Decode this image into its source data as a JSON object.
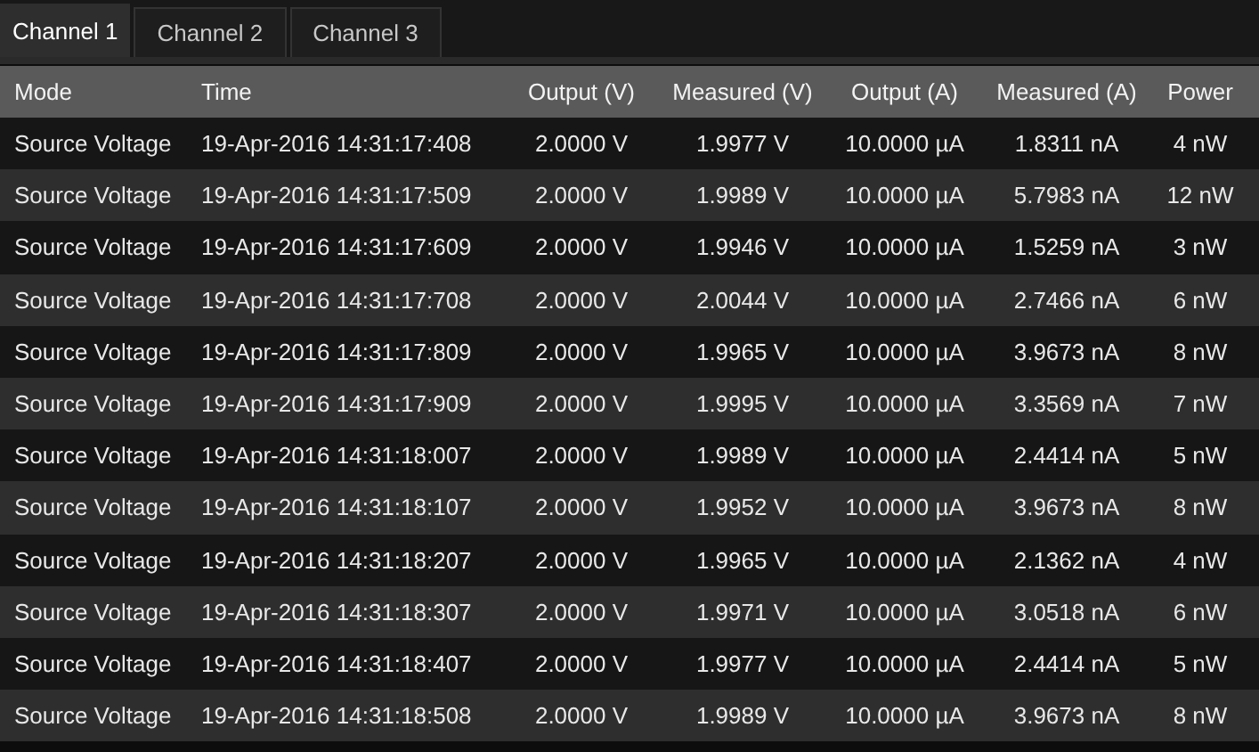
{
  "tabs": [
    {
      "label": "Channel 1",
      "selected": true
    },
    {
      "label": "Channel 2",
      "selected": false
    },
    {
      "label": "Channel 3",
      "selected": false
    }
  ],
  "table": {
    "columns": [
      "Mode",
      "Time",
      "Output (V)",
      "Measured (V)",
      "Output (A)",
      "Measured (A)",
      "Power"
    ],
    "rows": [
      [
        "Source Voltage",
        "19-Apr-2016 14:31:17:408",
        "2.0000 V",
        "1.9977 V",
        "10.0000 µA",
        "1.8311 nA",
        "4 nW"
      ],
      [
        "Source Voltage",
        "19-Apr-2016 14:31:17:509",
        "2.0000 V",
        "1.9989 V",
        "10.0000 µA",
        "5.7983 nA",
        "12 nW"
      ],
      [
        "Source Voltage",
        "19-Apr-2016 14:31:17:609",
        "2.0000 V",
        "1.9946 V",
        "10.0000 µA",
        "1.5259 nA",
        "3 nW"
      ],
      [
        "Source Voltage",
        "19-Apr-2016 14:31:17:708",
        "2.0000 V",
        "2.0044 V",
        "10.0000 µA",
        "2.7466 nA",
        "6 nW"
      ],
      [
        "Source Voltage",
        "19-Apr-2016 14:31:17:809",
        "2.0000 V",
        "1.9965 V",
        "10.0000 µA",
        "3.9673 nA",
        "8 nW"
      ],
      [
        "Source Voltage",
        "19-Apr-2016 14:31:17:909",
        "2.0000 V",
        "1.9995 V",
        "10.0000 µA",
        "3.3569 nA",
        "7 nW"
      ],
      [
        "Source Voltage",
        "19-Apr-2016 14:31:18:007",
        "2.0000 V",
        "1.9989 V",
        "10.0000 µA",
        "2.4414 nA",
        "5 nW"
      ],
      [
        "Source Voltage",
        "19-Apr-2016 14:31:18:107",
        "2.0000 V",
        "1.9952 V",
        "10.0000 µA",
        "3.9673 nA",
        "8 nW"
      ],
      [
        "Source Voltage",
        "19-Apr-2016 14:31:18:207",
        "2.0000 V",
        "1.9965 V",
        "10.0000 µA",
        "2.1362 nA",
        "4 nW"
      ],
      [
        "Source Voltage",
        "19-Apr-2016 14:31:18:307",
        "2.0000 V",
        "1.9971 V",
        "10.0000 µA",
        "3.0518 nA",
        "6 nW"
      ],
      [
        "Source Voltage",
        "19-Apr-2016 14:31:18:407",
        "2.0000 V",
        "1.9977 V",
        "10.0000 µA",
        "2.4414 nA",
        "5 nW"
      ],
      [
        "Source Voltage",
        "19-Apr-2016 14:31:18:508",
        "2.0000 V",
        "1.9989 V",
        "10.0000 µA",
        "3.9673 nA",
        "8 nW"
      ]
    ]
  }
}
